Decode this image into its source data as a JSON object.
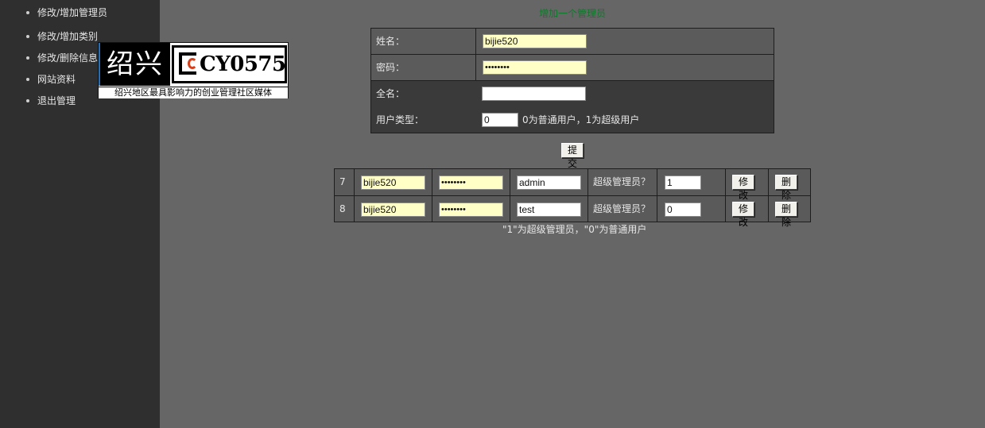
{
  "sidebar": {
    "items": [
      {
        "label": "修改/增加管理员"
      },
      {
        "label": "修改/增加类别"
      },
      {
        "label": "修改/删除信息"
      },
      {
        "label": "网站资料"
      },
      {
        "label": "退出管理"
      }
    ]
  },
  "logo": {
    "left_text": "绍兴",
    "brand": "CY0575",
    "slogan": "绍兴地区最具影响力的创业管理社区媒体"
  },
  "add_form": {
    "title": "增加一个管理员",
    "name_label": "姓名：",
    "name_value": "bijie520",
    "password_label": "密码：",
    "password_value": "••••••••",
    "fullname_label": "全名：",
    "fullname_value": "",
    "usertype_label": "用户类型：",
    "usertype_value": "0",
    "usertype_hint": "0为普通用户，1为超级用户",
    "submit_label": "提交"
  },
  "admins": [
    {
      "id": "7",
      "name": "bijie520",
      "password": "••••••••",
      "fullname": "admin",
      "super_label": "超级管理员？",
      "super_value": "1",
      "edit_label": "修改",
      "delete_label": "删除"
    },
    {
      "id": "8",
      "name": "bijie520",
      "password": "••••••••",
      "fullname": "test",
      "super_label": "超级管理员？",
      "super_value": "0",
      "edit_label": "修改",
      "delete_label": "删除"
    }
  ],
  "footer_note": "\"1\"为超级管理员，\"0\"为普通用户",
  "colors": {
    "sidebar_bg": "#2f2f2f",
    "page_bg": "#666666",
    "title_green": "#0d7a2a",
    "field_yellow": "#ffffc6"
  }
}
